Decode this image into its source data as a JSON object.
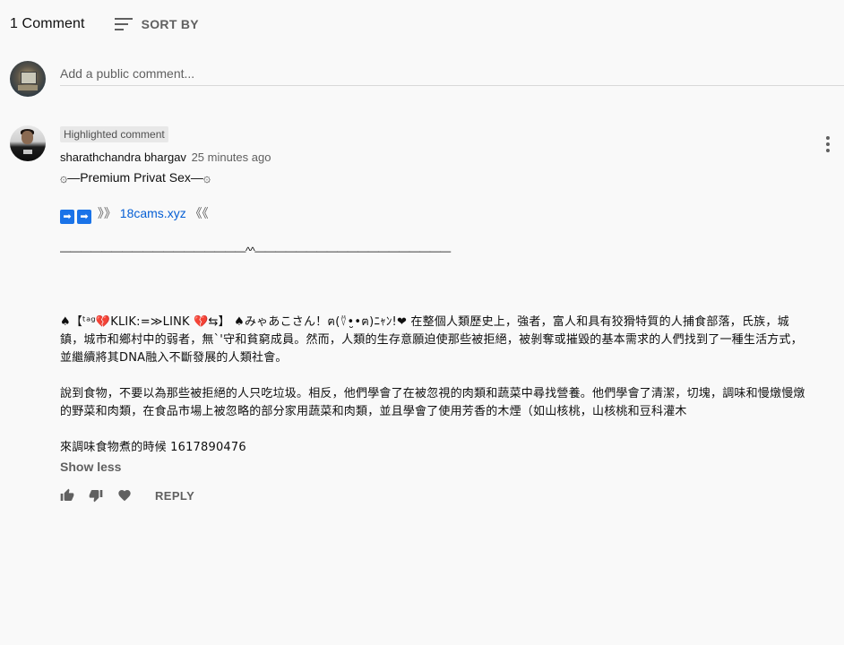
{
  "header": {
    "comment_count": "1 Comment",
    "sort_label": "SORT BY"
  },
  "add_comment": {
    "placeholder": "Add a public comment..."
  },
  "comment": {
    "badge": "Highlighted comment",
    "author": "sharathchandra bhargav",
    "time": "25 minutes ago",
    "line1": "۞—Premium Privat Sex—۞",
    "line2_prefix": "➡➡》》",
    "link": "18cams.xyz",
    "line2_suffix": "《《",
    "line3": "——————————————————^^———————————————————",
    "para1": "♠【ᵗᵃᵍ💔KLIK:=≫LINK 💔⇆】 ♠みゃあこさん！ฅ(⍢•̮•ฅ)ﾆｬﾝ!❤ 在整個人類歷史上，強者，富人和具有狡猾特質的人捕食部落，氏族，城鎮，城市和鄉村中的弱者，無`'守和貧窮成員。然而，人類的生存意願迫使那些被拒絕，被剝奪或摧毀的基本需求的人們找到了一種生活方式，並繼續將其DNA融入不斷發展的人類社會。",
    "para2": "說到食物，不要以為那些被拒絕的人只吃垃圾。相反，他們學會了在被忽視的肉類和蔬菜中尋找營養。他們學會了清潔，切塊，調味和慢燉慢燉的野菜和肉類，在食品市場上被忽略的部分家用蔬菜和肉類，並且學會了使用芳香的木煙（如山核桃，山核桃和豆科灌木",
    "para3": "來調味食物煮的時候 1617890476",
    "show_less": "Show less",
    "reply": "REPLY"
  },
  "icons": {
    "sort": "sort-icon",
    "more": "more-vert-icon",
    "like": "thumb-up-icon",
    "dislike": "thumb-down-icon",
    "heart": "heart-icon"
  },
  "colors": {
    "background": "#f9f9f9",
    "link": "#065fd4",
    "secondary_text": "#606060",
    "badge_bg": "#e8e8e8"
  }
}
